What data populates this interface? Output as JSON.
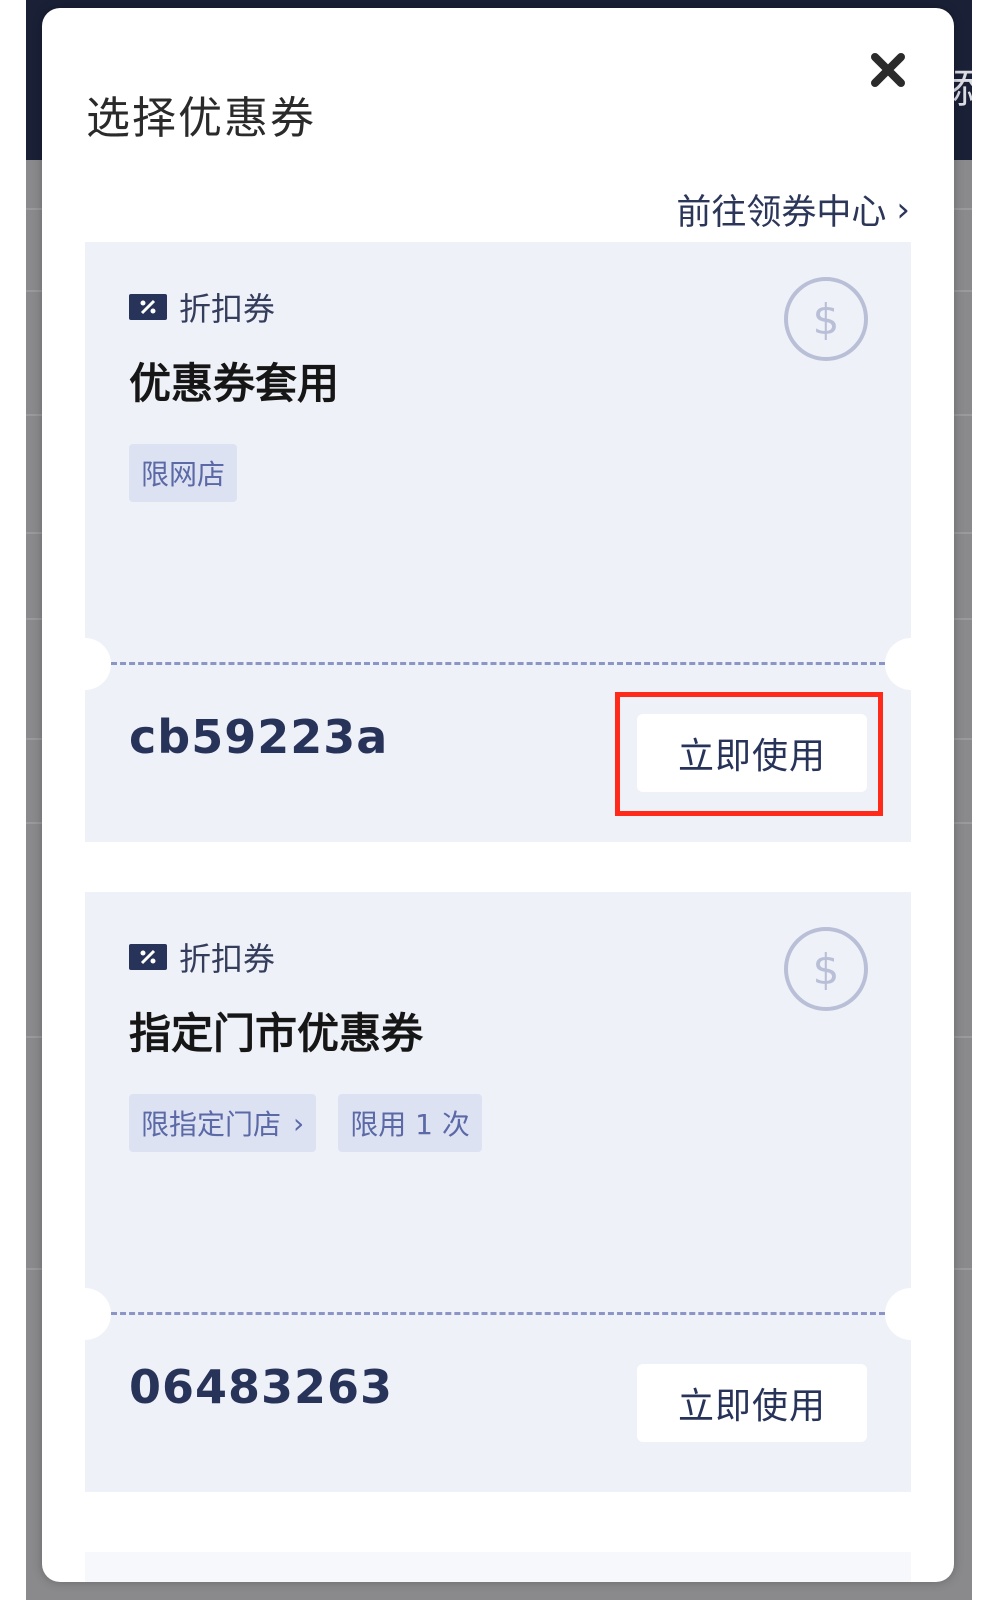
{
  "background": {
    "header_text": "添"
  },
  "modal": {
    "title": "选择优惠券",
    "close_icon": "close-icon",
    "goto_link": "前往领券中心",
    "goto_chevron": "›"
  },
  "coupons": [
    {
      "type_label": "折扣券",
      "name": "优惠券套用",
      "tags": [
        {
          "label": "限网店",
          "chevron": ""
        }
      ],
      "code": "cb59223a",
      "button_label": "立即使用",
      "highlighted": true
    },
    {
      "type_label": "折扣券",
      "name": "指定门市优惠券",
      "tags": [
        {
          "label": "限指定门店",
          "chevron": "›"
        },
        {
          "label": "限用 1 次",
          "chevron": ""
        }
      ],
      "code": "06483263",
      "button_label": "立即使用",
      "highlighted": false
    }
  ],
  "colors": {
    "highlight_border": "#ff2a1a",
    "card_bg": "#eff1f8",
    "accent_text": "#28335a",
    "tag_bg": "#dde2f3",
    "tag_text": "#5b69a6"
  }
}
